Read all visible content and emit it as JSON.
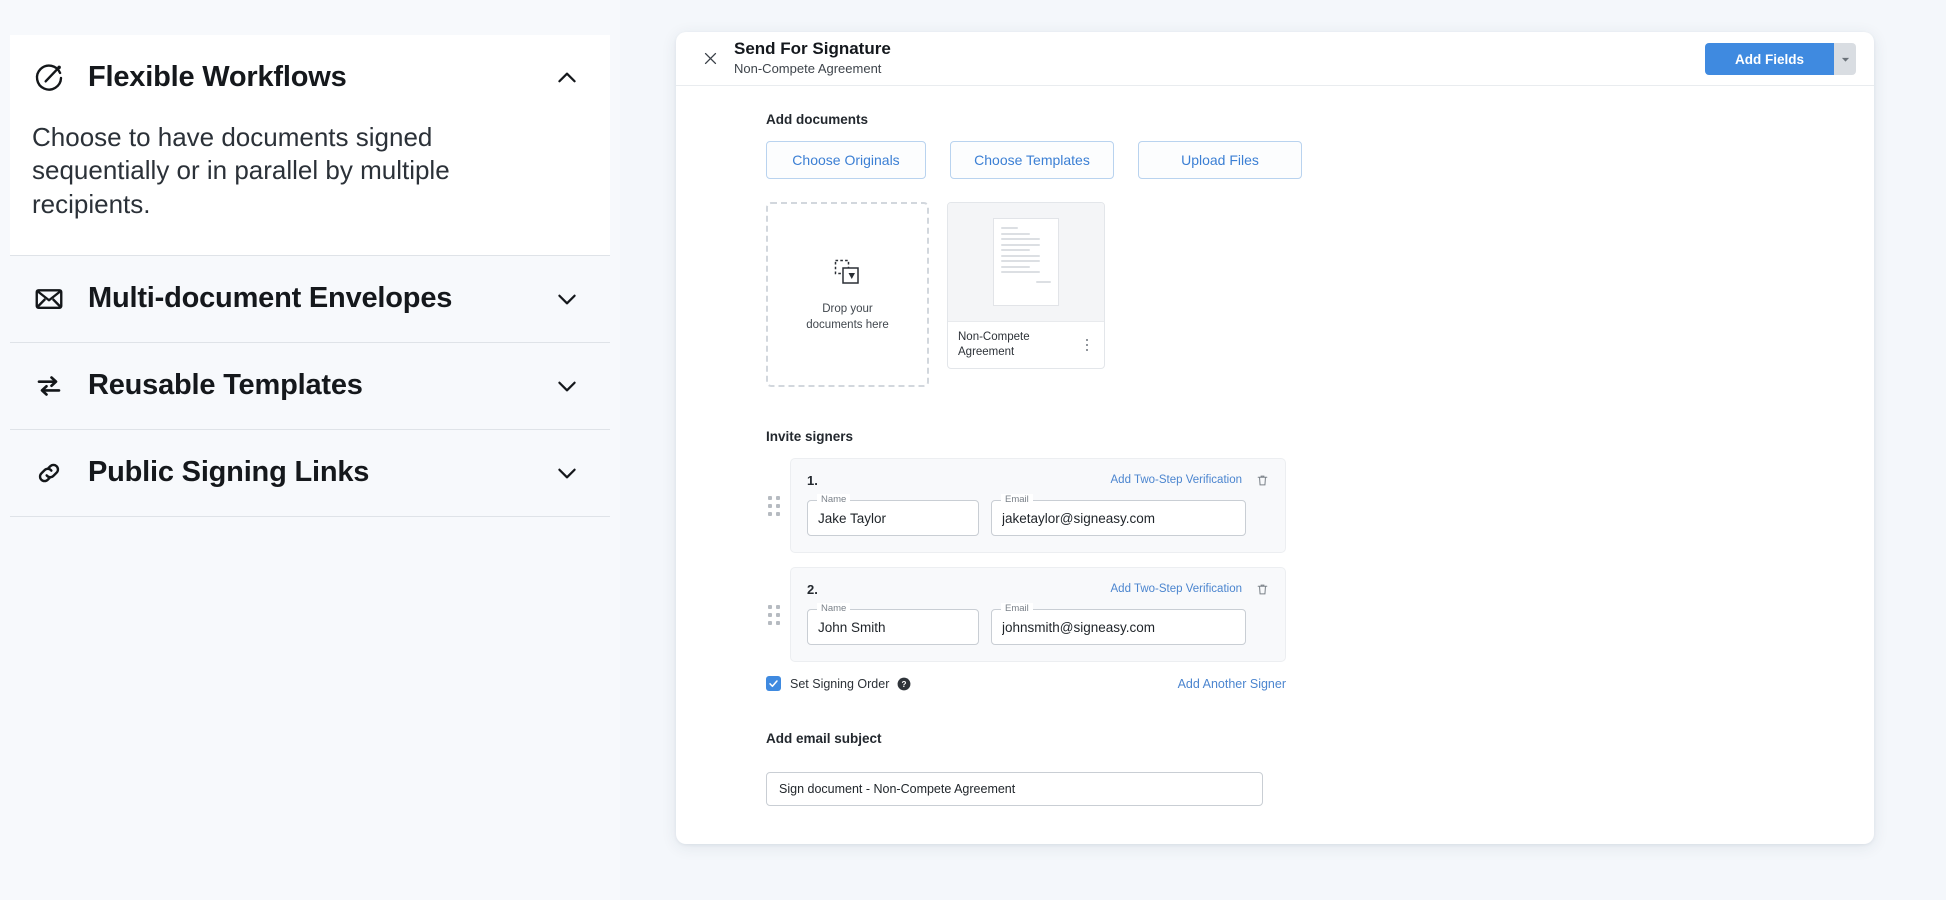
{
  "theme": {
    "page_bg": "#f4f7fb",
    "accent_blue": "#3f8ae0",
    "link_blue": "#4b85cf",
    "text_dark": "#15181c"
  },
  "sidebar": {
    "items": [
      {
        "icon": "workflow-circle-icon",
        "label": "Flexible Workflows",
        "expanded": true,
        "chevron": "chevron-up-icon",
        "body": "Choose to have documents signed sequentially or in parallel by multiple recipients."
      },
      {
        "icon": "envelope-icon",
        "label": "Multi-document Envelopes",
        "expanded": false,
        "chevron": "chevron-down-icon",
        "body": ""
      },
      {
        "icon": "swap-arrows-icon",
        "label": "Reusable Templates",
        "expanded": false,
        "chevron": "chevron-down-icon",
        "body": ""
      },
      {
        "icon": "link-chain-icon",
        "label": "Public Signing Links",
        "expanded": false,
        "chevron": "chevron-down-icon",
        "body": ""
      }
    ]
  },
  "modal": {
    "close_icon": "close-x-icon",
    "title": "Send For Signature",
    "subtitle": "Non-Compete Agreement",
    "primary_button": "Add Fields",
    "split_icon": "caret-down-icon",
    "documents": {
      "section_label": "Add documents",
      "buttons": [
        "Choose Originals",
        "Choose Templates",
        "Upload Files"
      ],
      "dropzone": {
        "icon": "drop-file-icon",
        "line1": "Drop your",
        "line2": "documents here"
      },
      "cards": [
        {
          "name": "Non-Compete Agreement",
          "menu_icon": "kebab-menu-icon"
        }
      ]
    },
    "signers": {
      "section_label": "Invite signers",
      "rows": [
        {
          "index": "1.",
          "two_step_link": "Add Two-Step Verification",
          "delete_icon": "trash-icon",
          "drag_icon": "drag-handle-icon",
          "name_label": "Name",
          "name_value": "Jake Taylor",
          "name_placeholder": "Name",
          "email_label": "Email",
          "email_value": "jaketaylor@signeasy.com",
          "email_placeholder": "Email"
        },
        {
          "index": "2.",
          "two_step_link": "Add Two-Step Verification",
          "delete_icon": "trash-icon",
          "drag_icon": "drag-handle-icon",
          "name_label": "Name",
          "name_value": "John Smith",
          "name_placeholder": "Name",
          "email_label": "Email",
          "email_value": "johnsmith@signeasy.com",
          "email_placeholder": "Email"
        }
      ],
      "signing_order_label": "Set Signing Order",
      "signing_order_checked": true,
      "help_icon": "help-circle-icon",
      "add_another": "Add Another Signer"
    },
    "email_subject": {
      "section_label": "Add email subject",
      "value": "Sign document - Non-Compete Agreement",
      "placeholder": "Add email subject"
    }
  }
}
